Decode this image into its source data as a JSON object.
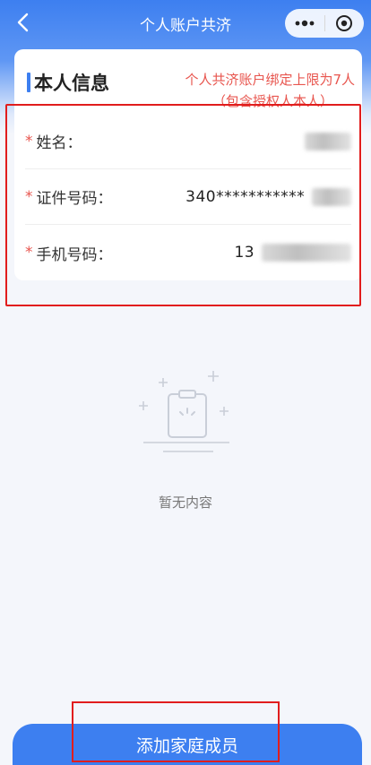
{
  "nav": {
    "title": "个人账户共济",
    "back_icon": "chevron-left-icon",
    "more_icon": "more-dots-icon",
    "close_icon": "target-close-icon"
  },
  "card": {
    "title": "本人信息",
    "limit_note_line1": "个人共济账户绑定上限为7人",
    "limit_note_line2": "（包含授权人本人）",
    "fields": [
      {
        "required": "*",
        "label": "姓名：",
        "value": ""
      },
      {
        "required": "*",
        "label": "证件号码：",
        "value": "340***********"
      },
      {
        "required": "*",
        "label": "手机号码：",
        "value": "13"
      }
    ]
  },
  "empty_state": {
    "icon": "empty-clipboard-icon",
    "text": "暂无内容"
  },
  "actions": {
    "add_family_member": "添加家庭成员"
  },
  "colors": {
    "primary": "#3d7ff0",
    "note_red": "#e8564f",
    "highlight_red": "#e11d1d"
  }
}
